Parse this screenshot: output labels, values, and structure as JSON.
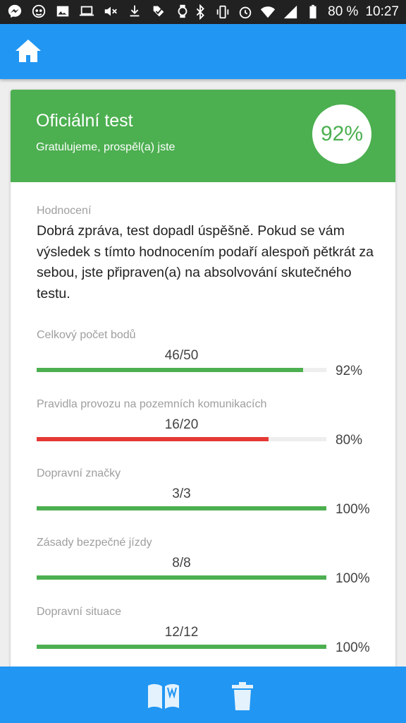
{
  "status_bar": {
    "battery_percent": "80 %",
    "time": "10:27",
    "left_icons": [
      "messenger-icon",
      "incognito-icon",
      "image-icon",
      "laptop-icon",
      "mute-icon",
      "download-icon",
      "check-icon",
      "watch-icon"
    ],
    "right_icons": [
      "bluetooth-icon",
      "vibrate-icon",
      "alarm-icon",
      "wifi-icon",
      "signal-icon",
      "battery-icon"
    ]
  },
  "app_bar": {
    "icon": "home-icon",
    "color": "#2196f3"
  },
  "result": {
    "title": "Oficiální test",
    "subtitle": "Gratulujeme, prospěl(a) jste",
    "score_percent": "92%",
    "header_color": "#4caf50"
  },
  "evaluation": {
    "label": "Hodnocení",
    "text": "Dobrá zpráva, test dopadl úspěšně. Pokud se vám výsledek s tímto hodnocením podaří alespoň pětkrát za sebou, jste připraven(a) na absolvování skutečného testu."
  },
  "categories": [
    {
      "label": "Celkový počet bodů",
      "score": "46/50",
      "percent": "92%",
      "fill": 0.92,
      "color": "#4caf50"
    },
    {
      "label": "Pravidla provozu na pozemních komunikacích",
      "score": "16/20",
      "percent": "80%",
      "fill": 0.8,
      "color": "#e53935"
    },
    {
      "label": "Dopravní značky",
      "score": "3/3",
      "percent": "100%",
      "fill": 1.0,
      "color": "#4caf50"
    },
    {
      "label": "Zásady bezpečné jízdy",
      "score": "8/8",
      "percent": "100%",
      "fill": 1.0,
      "color": "#4caf50"
    },
    {
      "label": "Dopravní situace",
      "score": "12/12",
      "percent": "100%",
      "fill": 1.0,
      "color": "#4caf50"
    }
  ],
  "bottom_bar": {
    "icons": [
      "book-icon",
      "trash-icon"
    ]
  }
}
